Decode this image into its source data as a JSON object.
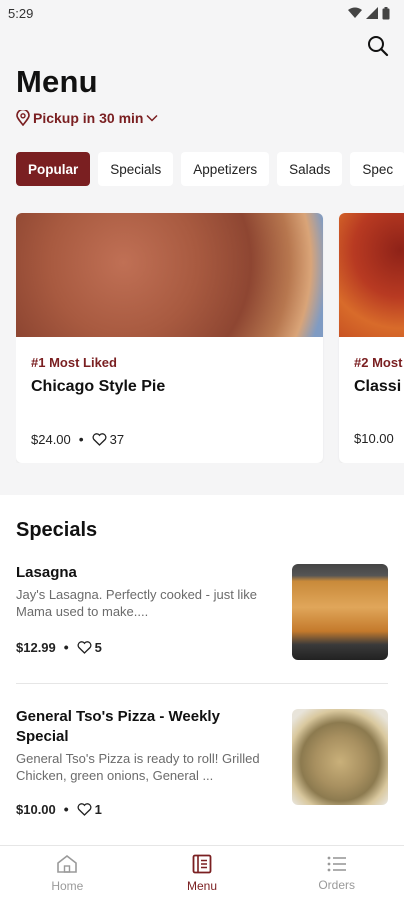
{
  "status": {
    "time": "5:29"
  },
  "header": {
    "title": "Menu",
    "pickup": "Pickup in 30 min"
  },
  "categories": [
    "Popular",
    "Specials",
    "Appetizers",
    "Salads",
    "Spec"
  ],
  "featured": [
    {
      "rank": "#1 Most Liked",
      "name": "Chicago Style Pie",
      "price": "$24.00",
      "likes": "37"
    },
    {
      "rank": "#2 Most",
      "name": "Classi",
      "price": "$10.00",
      "likes": ""
    }
  ],
  "specials": {
    "title": "Specials",
    "items": [
      {
        "name": "Lasagna",
        "description": "Jay's Lasagna.  Perfectly cooked - just like Mama used to make....",
        "price": "$12.99",
        "likes": "5"
      },
      {
        "name": "General Tso's Pizza - Weekly Special",
        "description": "General Tso's Pizza is ready to roll! Grilled Chicken, green onions, General ...",
        "price": "$10.00",
        "likes": "1"
      }
    ]
  },
  "nav": [
    {
      "label": "Home",
      "icon": "home-icon"
    },
    {
      "label": "Menu",
      "icon": "menu-book-icon"
    },
    {
      "label": "Orders",
      "icon": "list-icon"
    }
  ],
  "colors": {
    "accent": "#7a1f21"
  }
}
